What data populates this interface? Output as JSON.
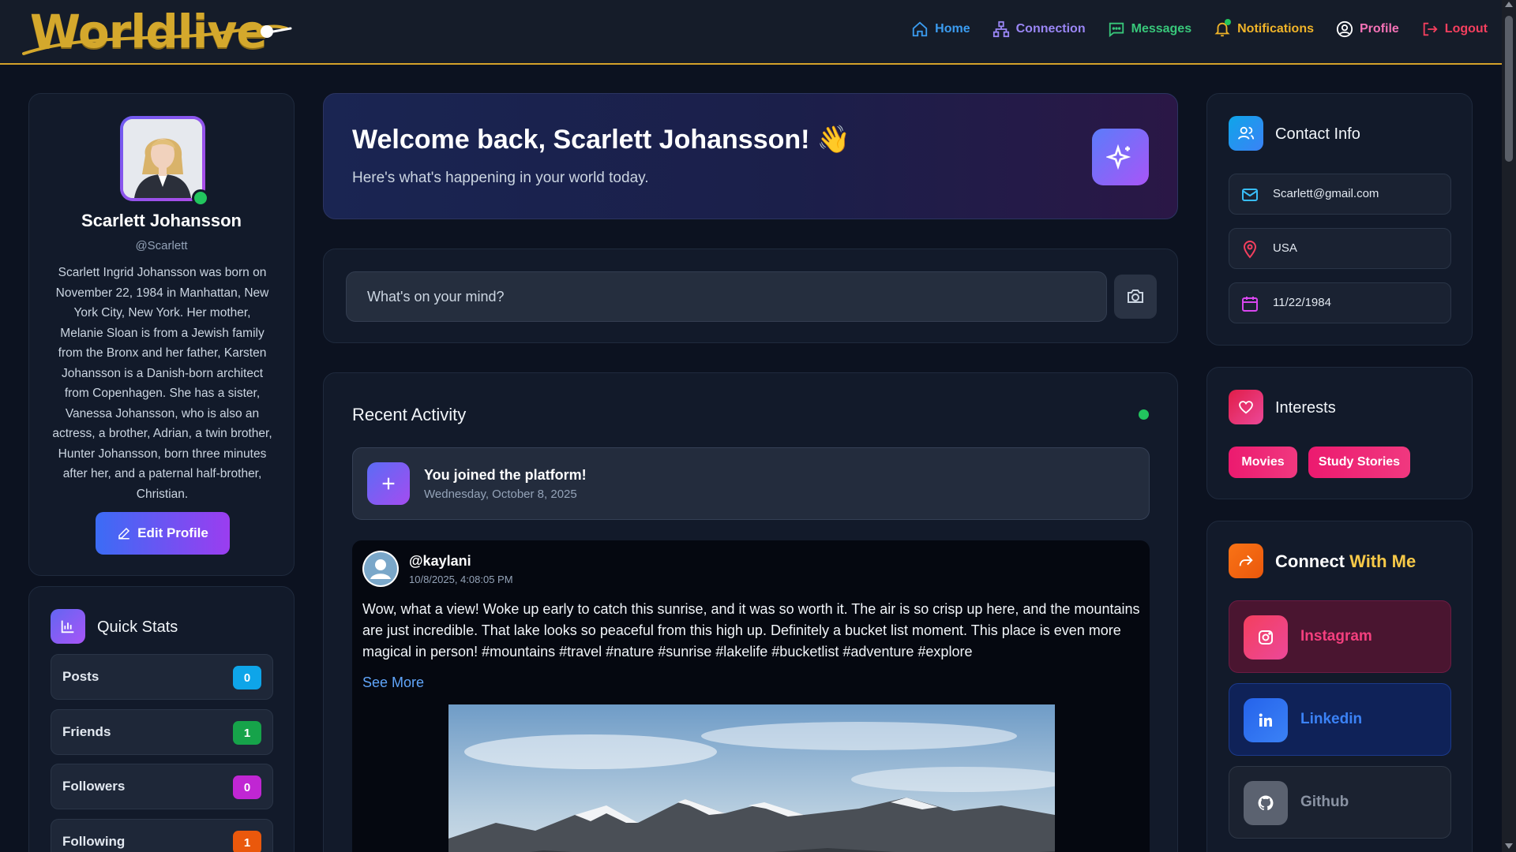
{
  "app": {
    "logo": "Worldlive"
  },
  "nav": {
    "home": "Home",
    "connection": "Connection",
    "messages": "Messages",
    "notifications": "Notifications",
    "profile": "Profile",
    "logout": "Logout"
  },
  "profile": {
    "name": "Scarlett Johansson",
    "handle": "@Scarlett",
    "bio": "Scarlett Ingrid Johansson was born on November 22, 1984 in Manhattan, New York City, New York. Her mother, Melanie Sloan is from a Jewish family from the Bronx and her father, Karsten Johansson is a Danish-born architect from Copenhagen. She has a sister, Vanessa Johansson, who is also an actress, a brother, Adrian, a twin brother, Hunter Johansson, born three minutes after her, and a paternal half-brother, Christian.",
    "edit_label": "Edit Profile"
  },
  "quick_stats": {
    "title": "Quick Stats",
    "items": [
      {
        "label": "Posts",
        "value": "0",
        "color": "#0ea5e9"
      },
      {
        "label": "Friends",
        "value": "1",
        "color": "#16a34a"
      },
      {
        "label": "Followers",
        "value": "0",
        "color": "#c026d3"
      },
      {
        "label": "Following",
        "value": "1",
        "color": "#ea580c"
      }
    ]
  },
  "welcome": {
    "title": "Welcome back, Scarlett Johansson! 👋",
    "subtitle": "Here's what's happening in your world today."
  },
  "composer": {
    "placeholder": "What's on your mind?"
  },
  "activity": {
    "title": "Recent Activity",
    "joined_title": "You joined the platform!",
    "joined_date": "Wednesday, October 8, 2025"
  },
  "post": {
    "user": "@kaylani",
    "time": "10/8/2025, 4:08:05 PM",
    "text": "Wow, what a view! Woke up early to catch this sunrise, and it was so worth it. The air is so crisp up here, and the mountains are just incredible. That lake looks so peaceful from this high up. Definitely a bucket list moment. This place is even more magical in person! #mountains #travel #nature #sunrise #lakelife #bucketlist #adventure #explore",
    "see_more": "See More"
  },
  "contact": {
    "title": "Contact Info",
    "email": "Scarlett@gmail.com",
    "location": "USA",
    "birthday": "11/22/1984"
  },
  "interests": {
    "title": "Interests",
    "tags": [
      "Movies",
      "Study Stories"
    ]
  },
  "connect": {
    "title_a": "Connect",
    "title_b": "With Me",
    "links": [
      "Instagram",
      "Linkedin",
      "Github"
    ]
  },
  "colors": {
    "accent_gold": "#d4a22a",
    "online": "#22c55e",
    "tag_pink": "#ec1a6f"
  }
}
